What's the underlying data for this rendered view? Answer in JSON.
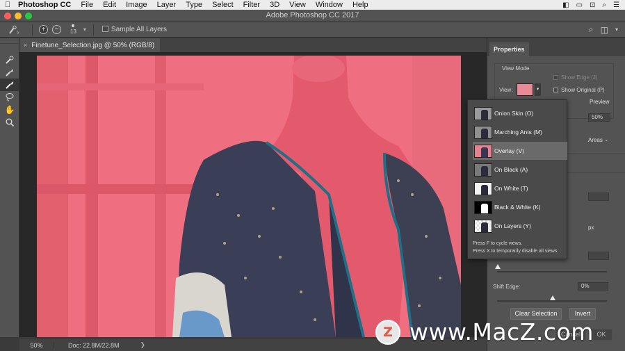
{
  "menubar": {
    "apple_icon": "apple-logo-icon",
    "app_name": "Photoshop CC",
    "items": [
      "File",
      "Edit",
      "Image",
      "Layer",
      "Type",
      "Select",
      "Filter",
      "3D",
      "View",
      "Window",
      "Help"
    ]
  },
  "window": {
    "title": "Adobe Photoshop CC 2017"
  },
  "options": {
    "brush_size": "13",
    "sample_all_layers": "Sample All Layers"
  },
  "document": {
    "tab_title": "Finetune_Selection.jpg @ 50% (RGB/8)",
    "close_glyph": "×"
  },
  "status": {
    "zoom": "50%",
    "doc_info": "Doc: 22.8M/22.8M",
    "arrow": "❯"
  },
  "properties": {
    "tab": "Properties",
    "view_mode_label": "View Mode",
    "view_label": "View:",
    "show_edge": "Show Edge (J)",
    "show_original": "Show Original (P)",
    "preview": "Preview",
    "percent": "50%",
    "areas": "Areas",
    "px": "px",
    "shift_edge_label": "Shift Edge:",
    "shift_edge_value": "0%",
    "clear_selection": "Clear Selection",
    "invert": "Invert",
    "cancel": "Cancel",
    "ok": "OK"
  },
  "view_popup": {
    "items": [
      {
        "label": "Onion Skin (O)"
      },
      {
        "label": "Marching Ants (M)"
      },
      {
        "label": "Overlay (V)",
        "selected": true
      },
      {
        "label": "On Black (A)"
      },
      {
        "label": "On White (T)"
      },
      {
        "label": "Black & White (K)"
      },
      {
        "label": "On Layers (Y)"
      }
    ],
    "hint1": "Press F to cycle views.",
    "hint2": "Press X to temporarily disable all views."
  },
  "watermark": {
    "logo_letter": "Z",
    "text": "www.MacZ.com"
  },
  "colors": {
    "overlay_red": "#ef6f80",
    "panel_bg": "#535353",
    "app_bg": "#3a3a3a"
  }
}
